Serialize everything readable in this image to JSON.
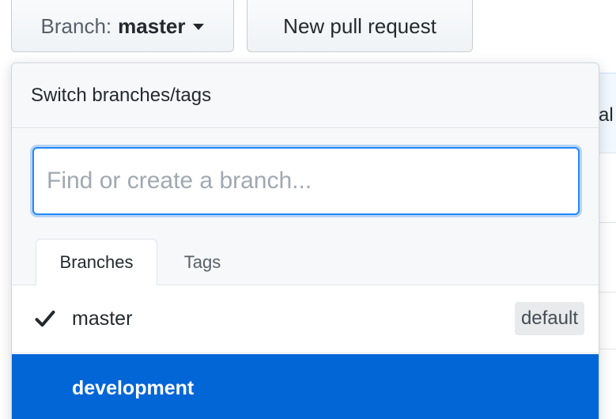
{
  "toolbar": {
    "branch_prefix": "Branch:",
    "branch_name": "master",
    "new_pull_request_label": "New pull request"
  },
  "background": {
    "partial_text": "al"
  },
  "dropdown": {
    "title": "Switch branches/tags",
    "search": {
      "placeholder": "Find or create a branch...",
      "value": ""
    },
    "tabs": [
      {
        "label": "Branches",
        "active": true
      },
      {
        "label": "Tags",
        "active": false
      }
    ],
    "items": [
      {
        "label": "master",
        "checked": true,
        "badge": "default",
        "highlighted": false
      },
      {
        "label": "development",
        "checked": false,
        "badge": "",
        "highlighted": true
      }
    ]
  },
  "colors": {
    "accent": "#0366d6",
    "focus_border": "#2188ff"
  },
  "icons": {
    "caret": "caret-down-icon",
    "check": "check-icon"
  }
}
